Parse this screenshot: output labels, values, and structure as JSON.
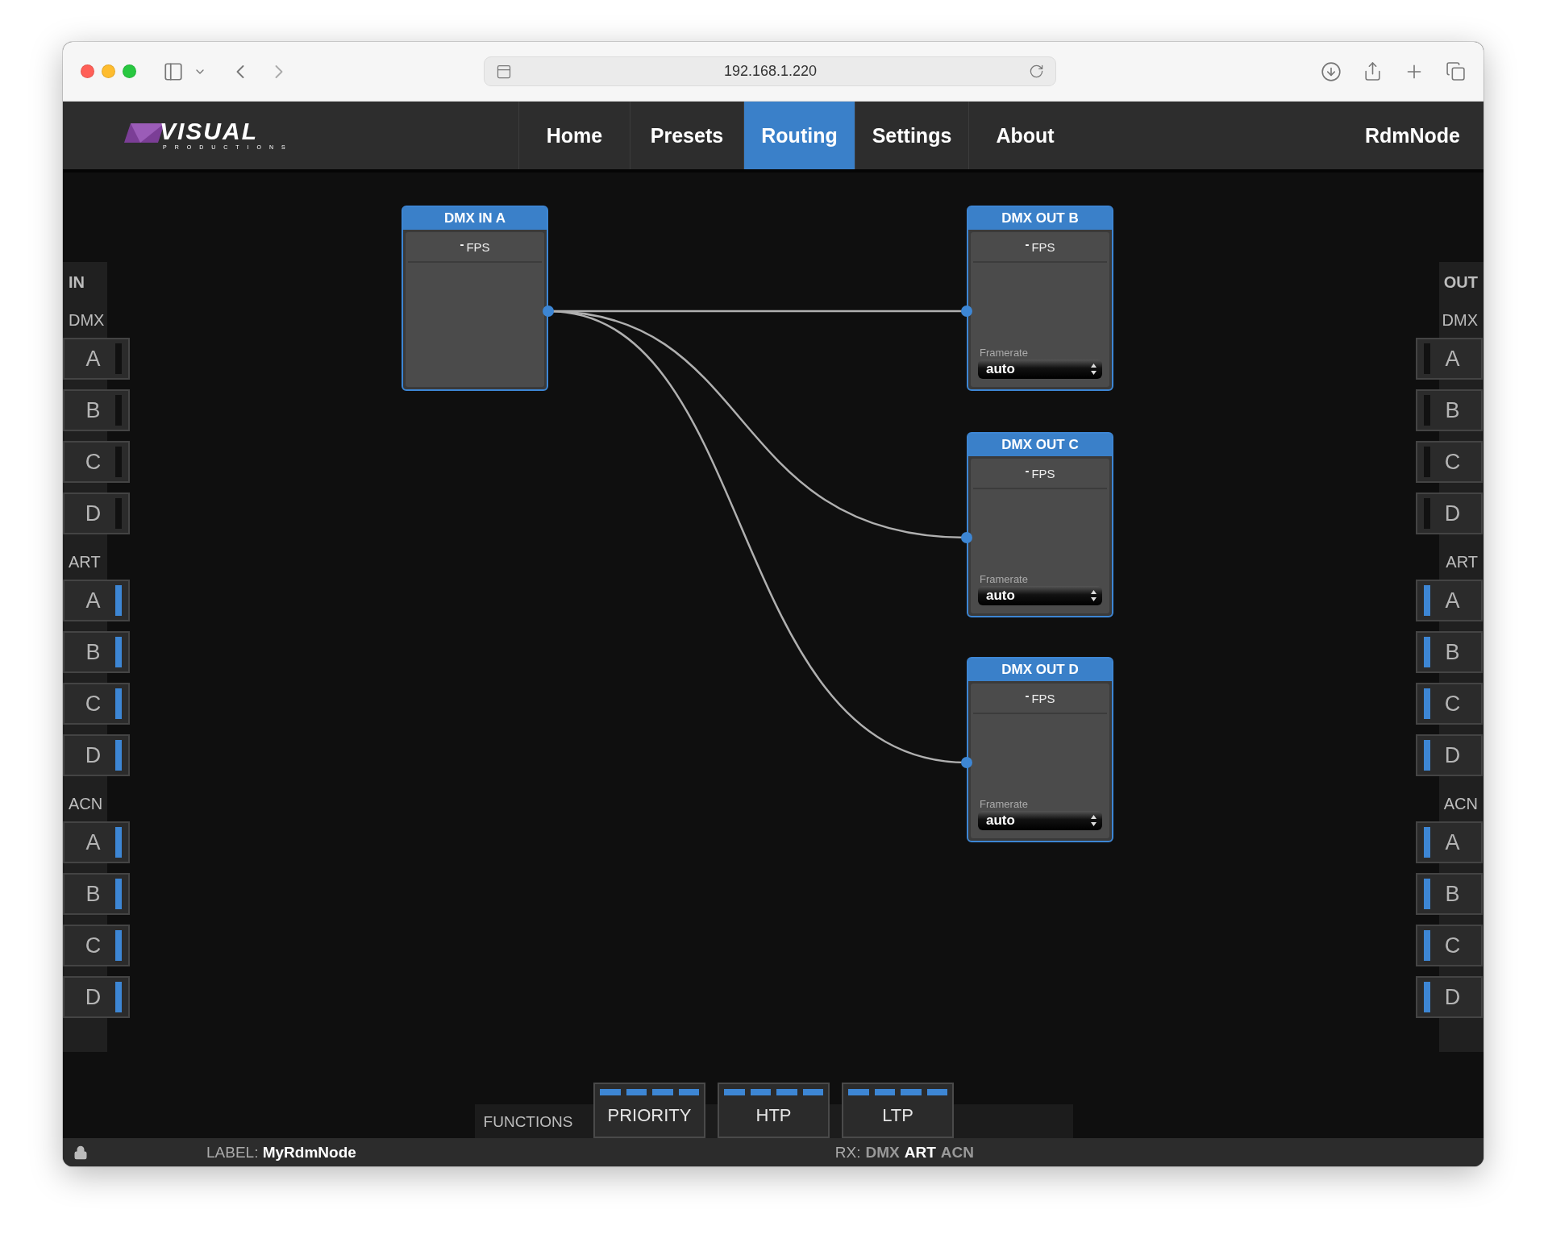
{
  "browser": {
    "url": "192.168.1.220"
  },
  "logo": {
    "name": "VISUAL",
    "tagline": "PRODUCTIONS"
  },
  "nav": [
    {
      "label": "Home",
      "selected": false
    },
    {
      "label": "Presets",
      "selected": false
    },
    {
      "label": "Routing",
      "selected": true
    },
    {
      "label": "Settings",
      "selected": false
    },
    {
      "label": "About",
      "selected": false
    }
  ],
  "device_name": "RdmNode",
  "inputs": {
    "heading": "IN",
    "groups": [
      {
        "label": "DMX",
        "ports": [
          {
            "label": "A",
            "active": false
          },
          {
            "label": "B",
            "active": false
          },
          {
            "label": "C",
            "active": false
          },
          {
            "label": "D",
            "active": false
          }
        ]
      },
      {
        "label": "ART",
        "ports": [
          {
            "label": "A",
            "active": true
          },
          {
            "label": "B",
            "active": true
          },
          {
            "label": "C",
            "active": true
          },
          {
            "label": "D",
            "active": true
          }
        ]
      },
      {
        "label": "ACN",
        "ports": [
          {
            "label": "A",
            "active": true
          },
          {
            "label": "B",
            "active": true
          },
          {
            "label": "C",
            "active": true
          },
          {
            "label": "D",
            "active": true
          }
        ]
      }
    ]
  },
  "outputs": {
    "heading": "OUT",
    "groups": [
      {
        "label": "DMX",
        "ports": [
          {
            "label": "A",
            "active": false
          },
          {
            "label": "B",
            "active": false
          },
          {
            "label": "C",
            "active": false
          },
          {
            "label": "D",
            "active": false
          }
        ]
      },
      {
        "label": "ART",
        "ports": [
          {
            "label": "A",
            "active": true
          },
          {
            "label": "B",
            "active": true
          },
          {
            "label": "C",
            "active": true
          },
          {
            "label": "D",
            "active": true
          }
        ]
      },
      {
        "label": "ACN",
        "ports": [
          {
            "label": "A",
            "active": true
          },
          {
            "label": "B",
            "active": true
          },
          {
            "label": "C",
            "active": true
          },
          {
            "label": "D",
            "active": true
          }
        ]
      }
    ]
  },
  "nodes": [
    {
      "kind": "input",
      "title": "DMX IN A",
      "fps_value": "-",
      "fps_unit": "FPS"
    },
    {
      "kind": "output",
      "title": "DMX OUT B",
      "fps_value": "-",
      "fps_unit": "FPS",
      "framerate_label": "Framerate",
      "framerate": "auto",
      "connected": true
    },
    {
      "kind": "output",
      "title": "DMX OUT C",
      "fps_value": "-",
      "fps_unit": "FPS",
      "framerate_label": "Framerate",
      "framerate": "auto",
      "connected": true
    },
    {
      "kind": "output",
      "title": "DMX OUT D",
      "fps_value": "-",
      "fps_unit": "FPS",
      "framerate_label": "Framerate",
      "framerate": "auto",
      "connected": true
    }
  ],
  "functions": {
    "label": "FUNCTIONS",
    "buttons": [
      {
        "label": "PRIORITY",
        "indicators": [
          true,
          true,
          true,
          true
        ]
      },
      {
        "label": "HTP",
        "indicators": [
          true,
          true,
          true,
          true
        ]
      },
      {
        "label": "LTP",
        "indicators": [
          true,
          true,
          true,
          true
        ]
      }
    ]
  },
  "status_bar": {
    "locked": true,
    "label": "LABEL: **MyRdmNode**",
    "rx_label": "RX:",
    "rx": [
      {
        "label": "DMX",
        "active": false
      },
      {
        "label": "ART",
        "active": true
      },
      {
        "label": "ACN",
        "active": false
      }
    ]
  }
}
